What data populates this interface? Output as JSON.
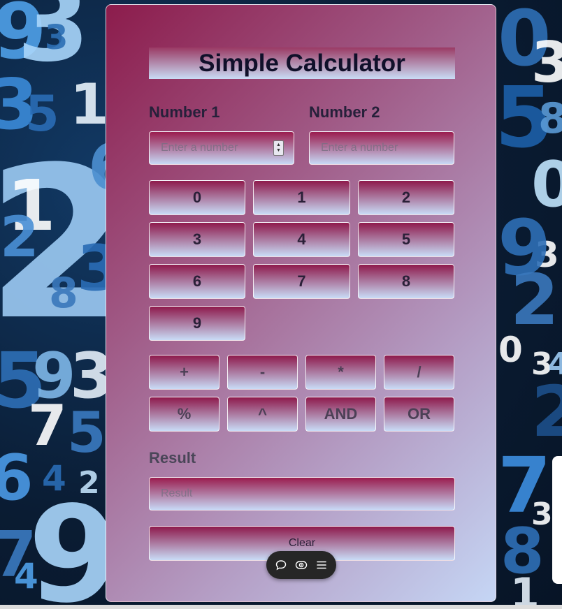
{
  "app": {
    "title": "Simple Calculator"
  },
  "inputs": {
    "number1_label": "Number 1",
    "number2_label": "Number 2",
    "number1_placeholder": "Enter a number",
    "number2_placeholder": "Enter a number",
    "number1_value": "",
    "number2_value": ""
  },
  "digits": [
    "0",
    "1",
    "2",
    "3",
    "4",
    "5",
    "6",
    "7",
    "8",
    "9"
  ],
  "operators": [
    "+",
    "-",
    "*",
    "/",
    "%",
    "^",
    "AND",
    "OR"
  ],
  "result": {
    "label": "Result",
    "placeholder": "Result",
    "value": ""
  },
  "clear_label": "Clear",
  "toolbar": {
    "icons": [
      "comment-icon",
      "eye-icon",
      "menu-icon"
    ]
  },
  "background_digits": [
    "9",
    "3",
    "3",
    "3",
    "5",
    "1",
    "2",
    "1",
    "6",
    "2",
    "8",
    "3",
    "5",
    "9",
    "3",
    "7",
    "5",
    "6",
    "4",
    "2",
    "9",
    "7",
    "4",
    "0",
    "3",
    "5",
    "8",
    "0",
    "3",
    "9",
    "2",
    "3",
    "4",
    "0",
    "2",
    "7",
    "3",
    "8",
    "1"
  ],
  "colors": {
    "accent_top": "#8e1a4c",
    "accent_bottom": "#c9dcf7",
    "page_bg": "#0b1f3a"
  }
}
